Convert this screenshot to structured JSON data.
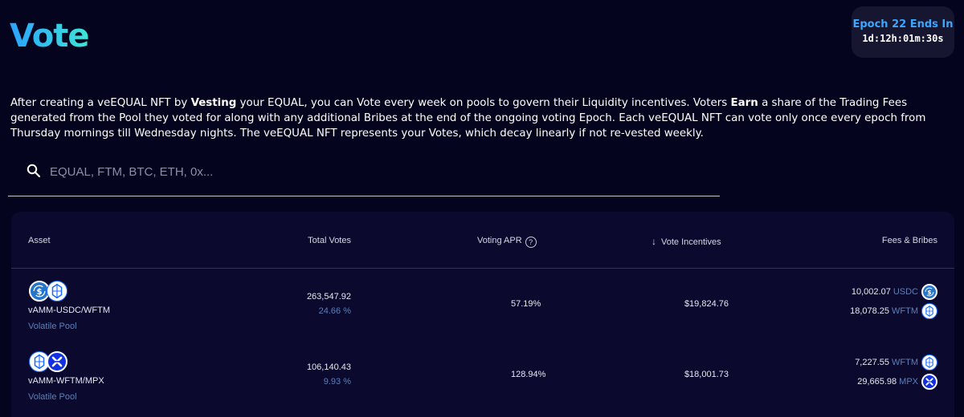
{
  "header": {
    "logo_text": "Vote",
    "epoch_title": "Epoch 22 Ends In",
    "epoch_countdown": "1d:12h:01m:30s"
  },
  "description": {
    "p1": "After creating a veEQUAL NFT by ",
    "b1": "Vesting",
    "p2": " your EQUAL, you can Vote every week on pools to govern their Liquidity incentives. Voters ",
    "b2": "Earn",
    "p3": " a share of the Trading Fees generated from the Pool they voted for along with any additional Bribes at the end of the ongoing voting Epoch. Each veEQUAL NFT can vote only once every epoch from Thursday mornings till Wednesday nights. The veEQUAL NFT represents your Votes, which decay linearly if not re-vested weekly."
  },
  "search": {
    "placeholder": "EQUAL, FTM, BTC, ETH, 0x...",
    "value": "",
    "icon": "search-icon"
  },
  "table": {
    "headers": {
      "asset": "Asset",
      "total_votes": "Total Votes",
      "voting_apr": "Voting APR",
      "help_icon_glyph": "?",
      "vote_incentives": "Vote Incentives",
      "sort_icon_glyph": "↓",
      "fees_bribes": "Fees & Bribes"
    },
    "rows": [
      {
        "tokens": [
          "usdc-token-icon",
          "wftm-token-icon"
        ],
        "name": "vAMM-USDC/WFTM",
        "type": "Volatile Pool",
        "total_votes": "263,547.92",
        "votes_pct": "24.66 %",
        "apr": "57.19%",
        "incentives": "$19,824.76",
        "fees": [
          {
            "amount": "10,002.07",
            "symbol": "USDC"
          },
          {
            "amount": "18,078.25",
            "symbol": "WFTM"
          }
        ]
      },
      {
        "tokens": [
          "wftm-token-icon",
          "mpx-token-icon"
        ],
        "name": "vAMM-WFTM/MPX",
        "type": "Volatile Pool",
        "total_votes": "106,140.43",
        "votes_pct": "9.93 %",
        "apr": "128.94%",
        "incentives": "$18,001.73",
        "fees": [
          {
            "amount": "7,227.55",
            "symbol": "WFTM"
          },
          {
            "amount": "29,665.98",
            "symbol": "MPX"
          }
        ]
      }
    ]
  },
  "colors": {
    "background": "#05041e",
    "table_bg": "#0b0a2e",
    "accent_blue": "#3aa6ff",
    "muted_text": "#5c7fb6",
    "usdc": "#2775ca",
    "wftm": "#1969ff",
    "mpx": "#1330e0"
  }
}
